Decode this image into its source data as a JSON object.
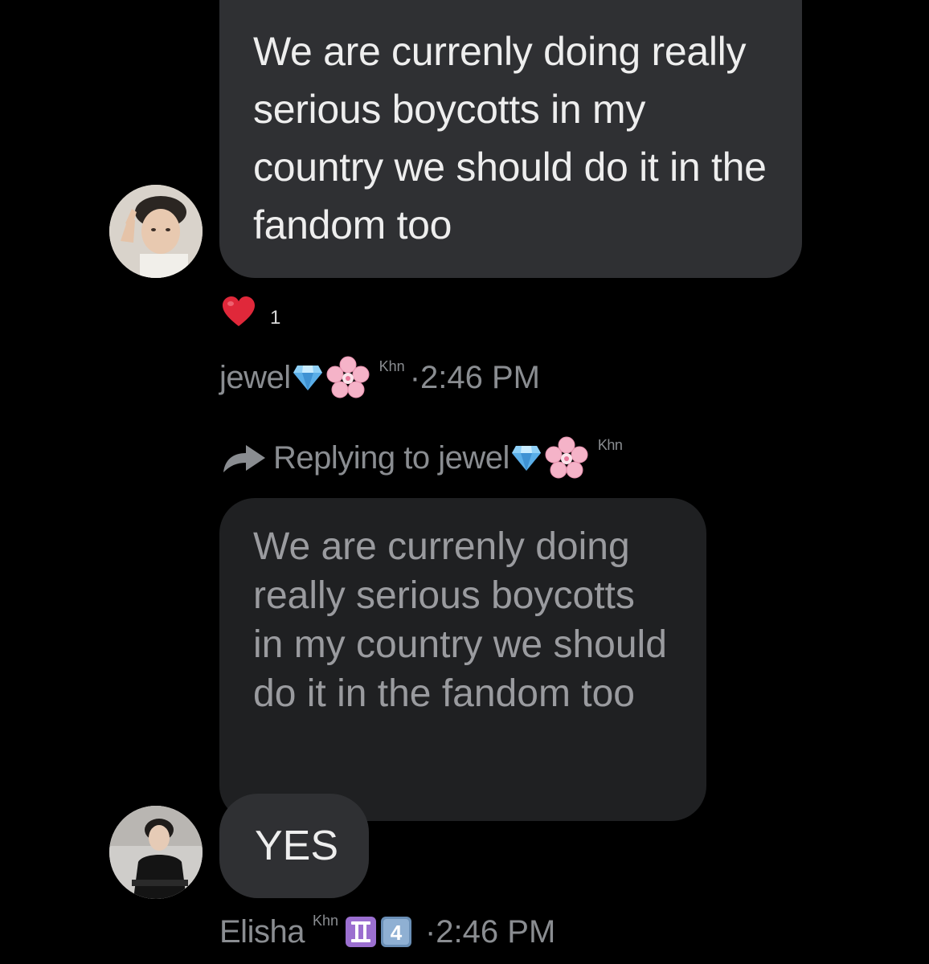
{
  "messages": [
    {
      "text": "We are currenly doing really serious boycotts in my country we should do it in the fandom too",
      "reaction": {
        "icon": "heart-icon",
        "count": "1"
      },
      "sender": "jewel",
      "sender_suffix": "Khn",
      "time": "·2:46 PM"
    },
    {
      "replying_to_label": "Replying to jewel",
      "replying_to_suffix": "Khn",
      "quoted_text": "We are currenly doing really serious boycotts in my country we should do it in the fandom too",
      "text": "YES",
      "sender": "Elisha",
      "sender_suffix": "Khn",
      "sender_badge_number": "4",
      "time": "·2:46 PM"
    }
  ],
  "colors": {
    "background": "#000000",
    "bubble": "#2f3033",
    "quote_bubble": "#1f2022",
    "meta_text": "#8a8d91",
    "heart": "#e0283a"
  },
  "icons": [
    "heart-icon",
    "gem-icon",
    "cherry-blossom-icon",
    "reply-arrow-icon",
    "gemini-icon",
    "keycap-4-icon"
  ]
}
